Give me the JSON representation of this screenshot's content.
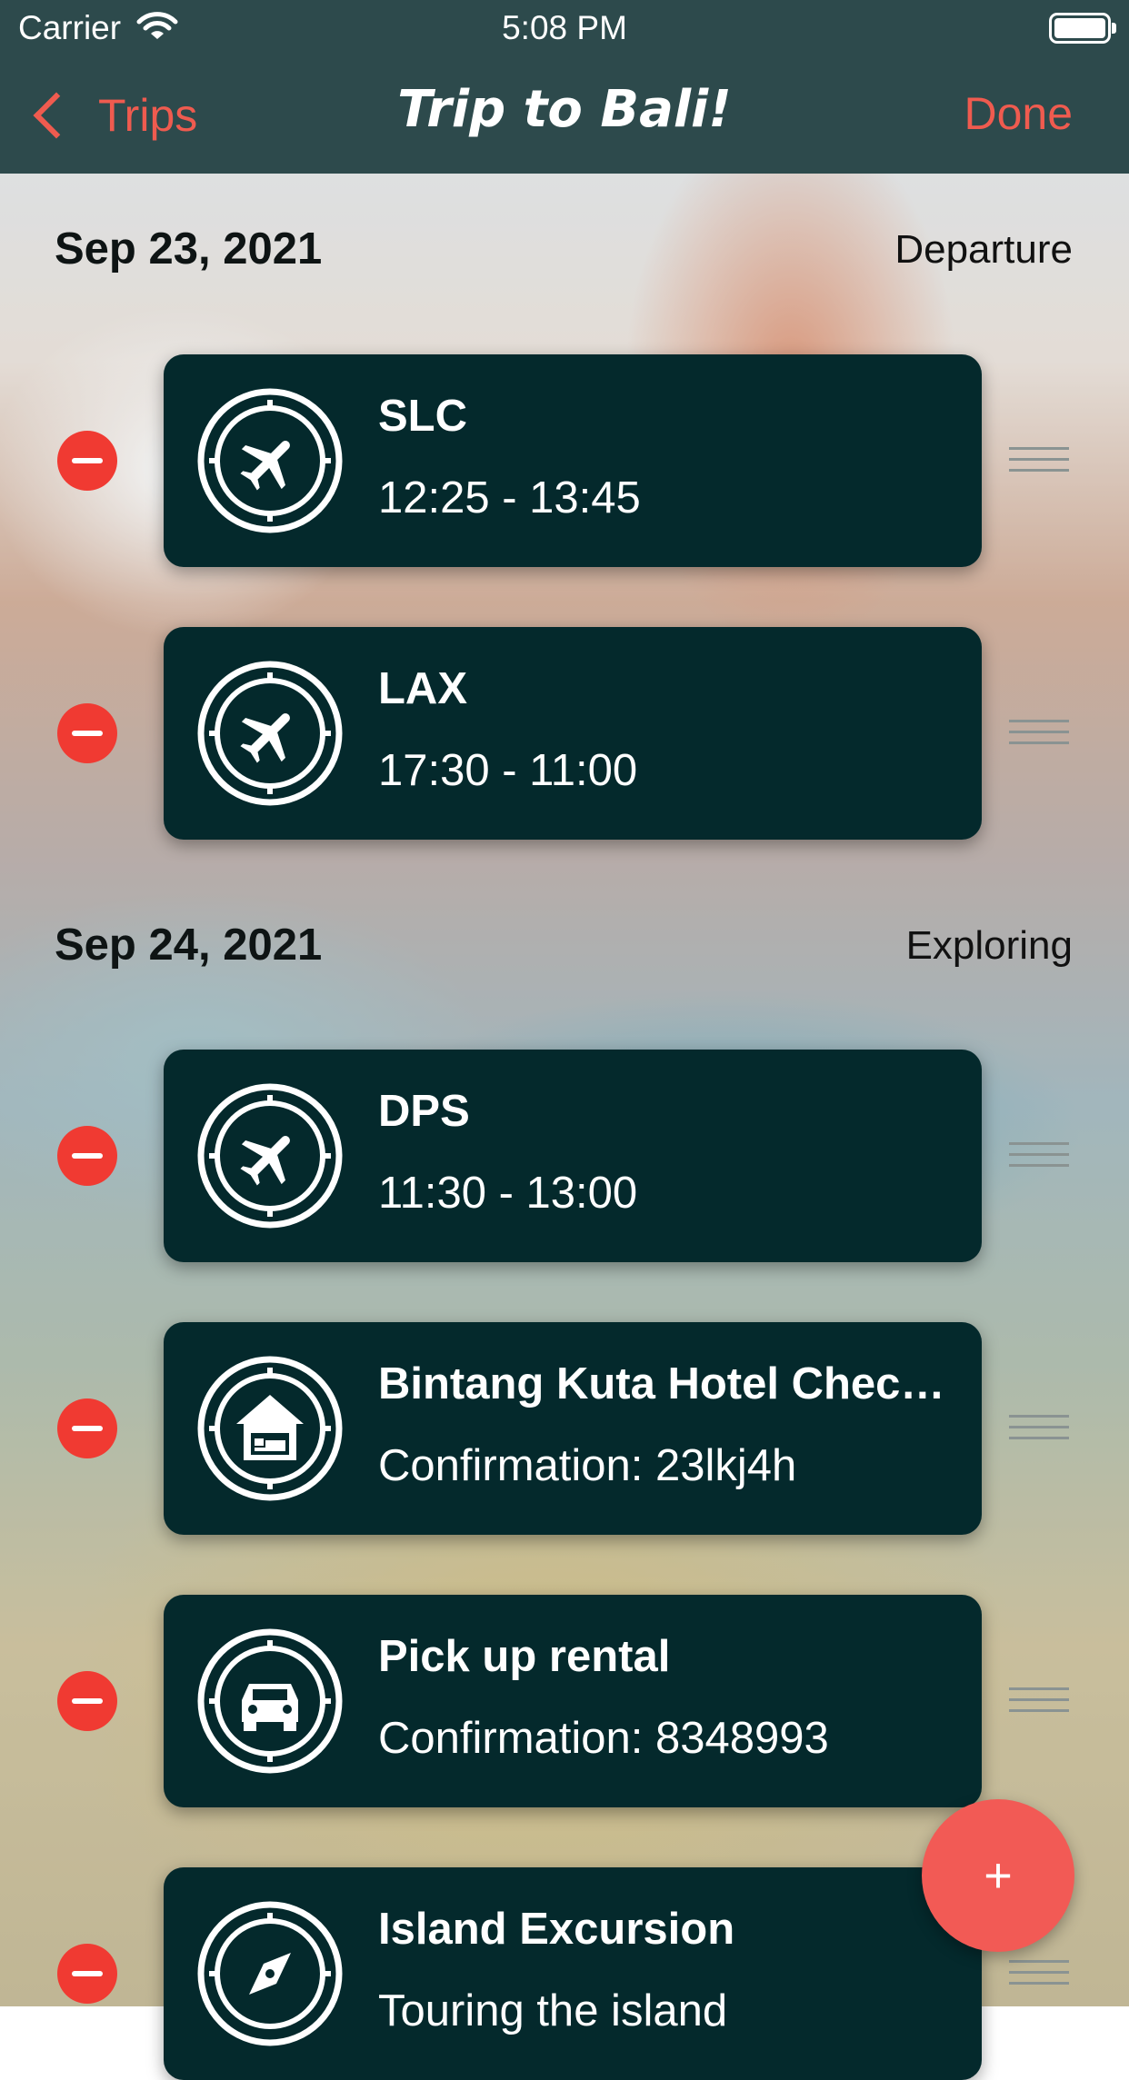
{
  "status_bar": {
    "carrier": "Carrier",
    "time": "5:08 PM"
  },
  "nav": {
    "back_label": "Trips",
    "title": "Trip to Bali!",
    "done_label": "Done"
  },
  "sections": [
    {
      "date": "Sep 23, 2021",
      "label": "Departure"
    },
    {
      "date": "Sep 24, 2021",
      "label": "Exploring"
    }
  ],
  "items": [
    {
      "title": "SLC",
      "subtitle": "12:25 - 13:45",
      "icon": "airplane-icon"
    },
    {
      "title": "LAX",
      "subtitle": "17:30 - 11:00",
      "icon": "airplane-icon"
    },
    {
      "title": "DPS",
      "subtitle": "11:30 - 13:00",
      "icon": "airplane-icon"
    },
    {
      "title": "Bintang Kuta Hotel Check-in",
      "subtitle": "Confirmation: 23lkj4h",
      "icon": "hotel-icon"
    },
    {
      "title": "Pick up rental",
      "subtitle": "Confirmation: 8348993",
      "icon": "car-icon"
    },
    {
      "title": "Island Excursion",
      "subtitle": "Touring the island",
      "icon": "compass-icon"
    }
  ],
  "fab": {
    "label": "+"
  },
  "colors": {
    "nav_bg": "#2d4a4c",
    "accent": "#ef5b4f",
    "card_bg": "#04292c",
    "delete": "#f03a32",
    "fab": "#f25a55"
  }
}
